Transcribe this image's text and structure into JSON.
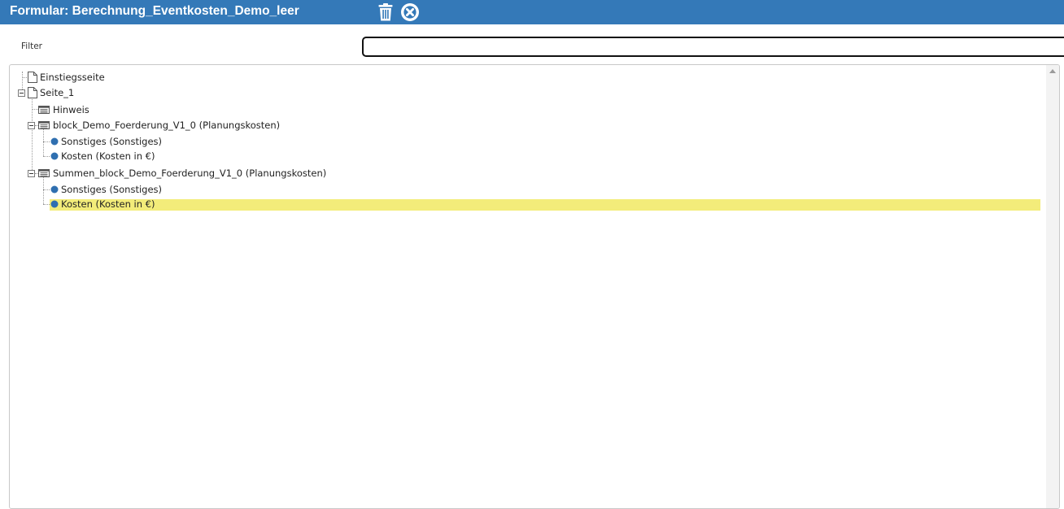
{
  "window": {
    "title": "Formular: Berechnung_Eventkosten_Demo_leer",
    "delete_icon": "trash-icon",
    "close_icon": "close-circle-icon"
  },
  "filter": {
    "label": "Filter",
    "value": "",
    "placeholder": ""
  },
  "tree": {
    "nodes": [
      {
        "label": "Einstiegsseite",
        "icon": "page-icon"
      },
      {
        "label": "Seite_1",
        "icon": "page-icon",
        "expanded": true
      },
      {
        "label": "Hinweis",
        "icon": "block-icon"
      },
      {
        "label": "block_Demo_Foerderung_V1_0 (Planungskosten)",
        "icon": "block-icon",
        "expanded": true
      },
      {
        "label": "Sonstiges (Sonstiges)",
        "icon": "field-dot-icon"
      },
      {
        "label": "Kosten (Kosten in €)",
        "icon": "field-dot-icon"
      },
      {
        "label": "Summen_block_Demo_Foerderung_V1_0 (Planungskosten)",
        "icon": "block-icon",
        "expanded": true
      },
      {
        "label": "Sonstiges (Sonstiges)",
        "icon": "field-dot-icon"
      },
      {
        "label": "Kosten (Kosten in €)",
        "icon": "field-dot-icon",
        "selected": true
      }
    ]
  },
  "colors": {
    "titlebar": "#3479b8",
    "selection_highlight": "#f3ec7a",
    "field_dot": "#2f6fb0"
  }
}
